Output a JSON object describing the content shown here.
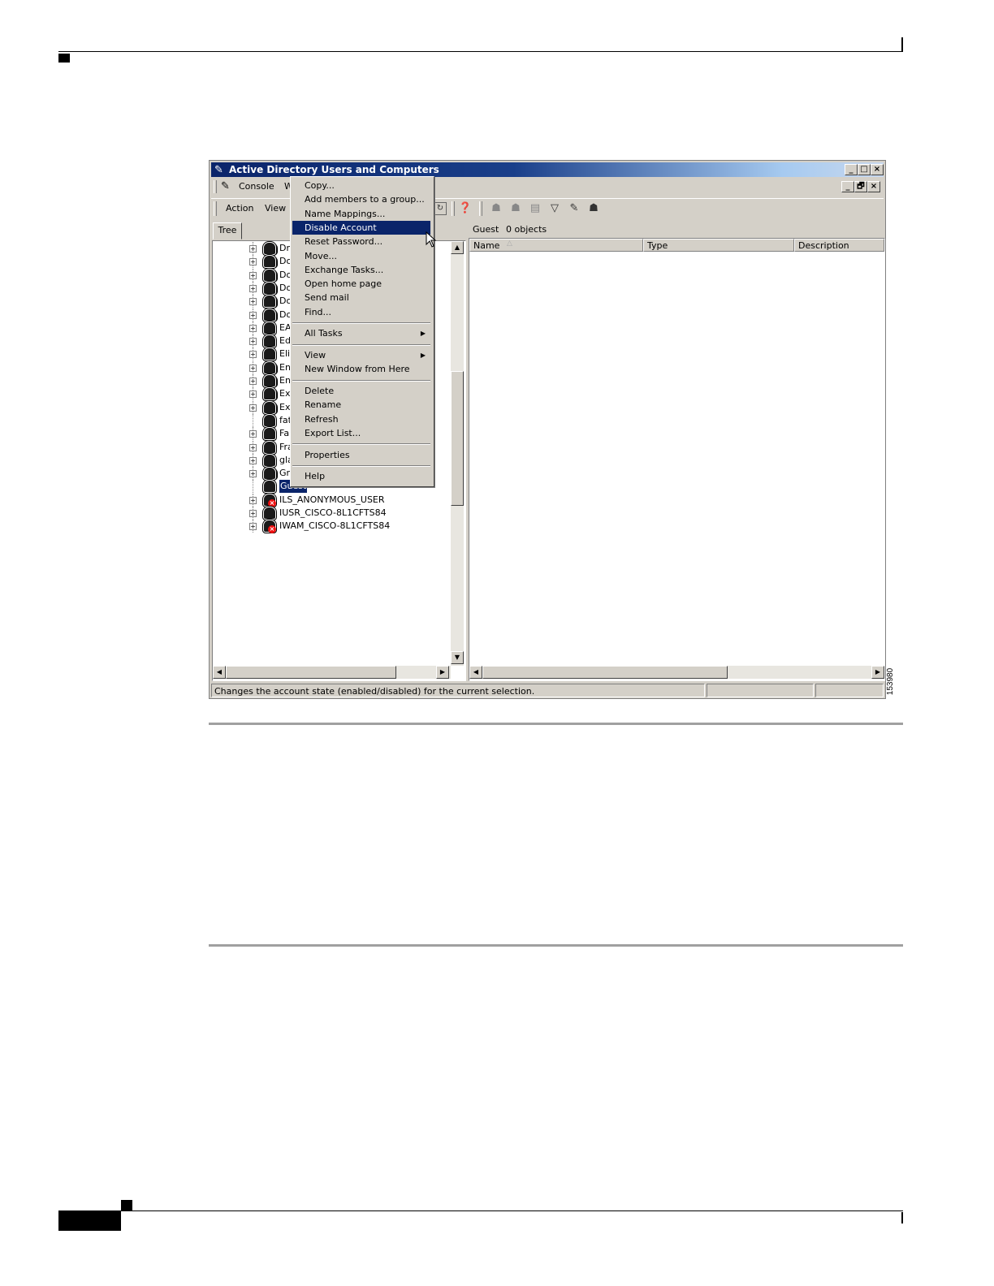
{
  "window": {
    "title": "Active Directory Users and Computers",
    "caption_buttons": [
      "_",
      "□",
      "×"
    ],
    "child_caption_buttons": [
      "_",
      "🗗",
      "×"
    ]
  },
  "menubar": {
    "console": "Console",
    "window_abbrev": "W",
    "action": "Action",
    "view": "View"
  },
  "tree": {
    "tab_label": "Tree",
    "rows": [
      {
        "label": "Dn",
        "plus": true,
        "group": true
      },
      {
        "label": "Do",
        "plus": true,
        "group": true
      },
      {
        "label": "Do",
        "plus": true,
        "group": true
      },
      {
        "label": "Do",
        "plus": true,
        "group": true
      },
      {
        "label": "Do",
        "plus": true,
        "group": true
      },
      {
        "label": "Do",
        "plus": true,
        "group": true
      },
      {
        "label": "EA",
        "plus": true,
        "group": false
      },
      {
        "label": "Ed",
        "plus": true,
        "group": false
      },
      {
        "label": "Eli",
        "plus": true,
        "group": false
      },
      {
        "label": "En",
        "plus": true,
        "group": true
      },
      {
        "label": "Ent",
        "plus": true,
        "group": true
      },
      {
        "label": "Exc",
        "plus": true,
        "group": true
      },
      {
        "label": "Exc",
        "plus": true,
        "group": true
      },
      {
        "label": "fat",
        "plus": false,
        "group": false
      },
      {
        "label": "Fa",
        "plus": true,
        "group": false
      },
      {
        "label": "Fra",
        "plus": true,
        "group": false
      },
      {
        "label": "gla",
        "plus": true,
        "group": false
      },
      {
        "label": "Gro",
        "plus": true,
        "group": true
      },
      {
        "label": "Guest",
        "plus": false,
        "group": false,
        "selected": true
      },
      {
        "label": "ILS_ANONYMOUS_USER",
        "plus": true,
        "group": false,
        "disabled": true
      },
      {
        "label": "IUSR_CISCO-8L1CFTS84",
        "plus": true,
        "group": false
      },
      {
        "label": "IWAM_CISCO-8L1CFTS84",
        "plus": true,
        "group": false,
        "disabled": true
      }
    ]
  },
  "details": {
    "folder": "Guest",
    "count": "0 objects",
    "columns": [
      "Name",
      "Type",
      "Description"
    ]
  },
  "context_menu": {
    "items": [
      {
        "label": "Copy..."
      },
      {
        "label": "Add members to a group..."
      },
      {
        "label": "Name Mappings..."
      },
      {
        "label": "Disable Account",
        "highlighted": true
      },
      {
        "label": "Reset Password..."
      },
      {
        "label": "Move..."
      },
      {
        "label": "Exchange Tasks..."
      },
      {
        "label": "Open home page"
      },
      {
        "label": "Send mail"
      },
      {
        "label": "Find..."
      },
      {
        "separator": true
      },
      {
        "label": "All Tasks",
        "submenu": true
      },
      {
        "separator": true
      },
      {
        "label": "View",
        "submenu": true
      },
      {
        "label": "New Window from Here"
      },
      {
        "separator": true
      },
      {
        "label": "Delete"
      },
      {
        "label": "Rename"
      },
      {
        "label": "Refresh"
      },
      {
        "label": "Export List..."
      },
      {
        "separator": true
      },
      {
        "label": "Properties"
      },
      {
        "separator": true
      },
      {
        "label": "Help"
      }
    ]
  },
  "statusbar": {
    "text": "Changes the account state (enabled/disabled) for the current selection."
  },
  "figure_number": "153980",
  "icons": [
    "console-icon",
    "refresh-icon",
    "help-icon",
    "new-user-icon",
    "new-group-icon",
    "new-ou-icon",
    "filter-icon",
    "find-icon",
    "delegate-icon"
  ]
}
